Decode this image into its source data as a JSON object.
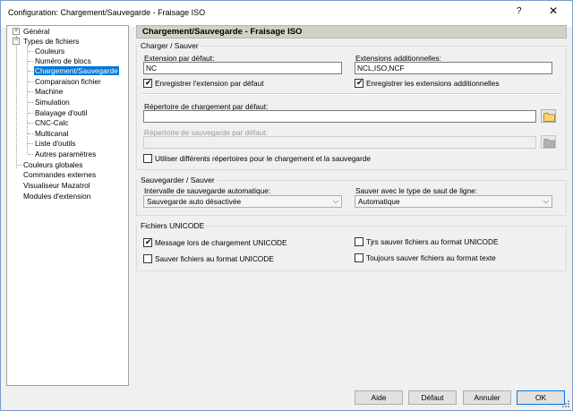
{
  "window": {
    "title": "Configuration: Chargement/Sauvegarde - Fraisage ISO",
    "help": "?",
    "close": "✕"
  },
  "tree": {
    "items": [
      {
        "label": "Général",
        "expander": "+"
      },
      {
        "label": "Types de fichiers",
        "expander": "−"
      },
      {
        "label": "Couleurs"
      },
      {
        "label": "Numéro de blocs"
      },
      {
        "label": "Chargement/Sauvegarde"
      },
      {
        "label": "Comparaison fichier"
      },
      {
        "label": "Machine"
      },
      {
        "label": "Simulation"
      },
      {
        "label": "Balayage d'outil"
      },
      {
        "label": "CNC-Calc"
      },
      {
        "label": "Multicanal"
      },
      {
        "label": "Liste d'outils"
      },
      {
        "label": "Autres paramètres"
      },
      {
        "label": "Couleurs globales"
      },
      {
        "label": "Commandes externes"
      },
      {
        "label": "Visualiseur Mazatrol"
      },
      {
        "label": "Modules d'extension"
      }
    ]
  },
  "panel": {
    "header": "Chargement/Sauvegarde - Fraisage ISO",
    "load_save": {
      "title": "Charger / Sauver",
      "default_ext_label": "Extension par défaut:",
      "default_ext_value": "NC",
      "save_ext_label": "Enregistrer l'extension par défaut",
      "add_ext_label": "Extensions additionnelles:",
      "add_ext_value": "NCL,ISO,NCF",
      "save_add_ext_label": "Enregistrer les extensions additionnelles",
      "load_dir_label": "Répertoire de chargement par défaut:",
      "load_dir_value": "",
      "save_dir_label": "Répertoire de sauvegarde par défaut:",
      "save_dir_value": "",
      "diff_dirs_label": "Utiliser différents répertoires pour le chargement et la sauvegarde"
    },
    "autosave": {
      "title": "Sauvegarder / Sauver",
      "interval_label": "Intervalle de sauvegarde automatique:",
      "interval_value": "Sauvegarde auto désactivée",
      "linebreak_label": "Sauver avec le type de saut de ligne:",
      "linebreak_value": "Automatique"
    },
    "unicode": {
      "title": "Fichiers UNICODE",
      "msg_label": "Message lors de chargement UNICODE",
      "save_unicode_label": "Sauver fichiers au format UNICODE",
      "always_unicode_label": "Tjrs sauver fichiers au format UNICODE",
      "always_text_label": "Toujours sauver fichiers au format texte"
    }
  },
  "buttons": {
    "help": "Aide",
    "default": "Défaut",
    "cancel": "Annuler",
    "ok": "OK"
  }
}
